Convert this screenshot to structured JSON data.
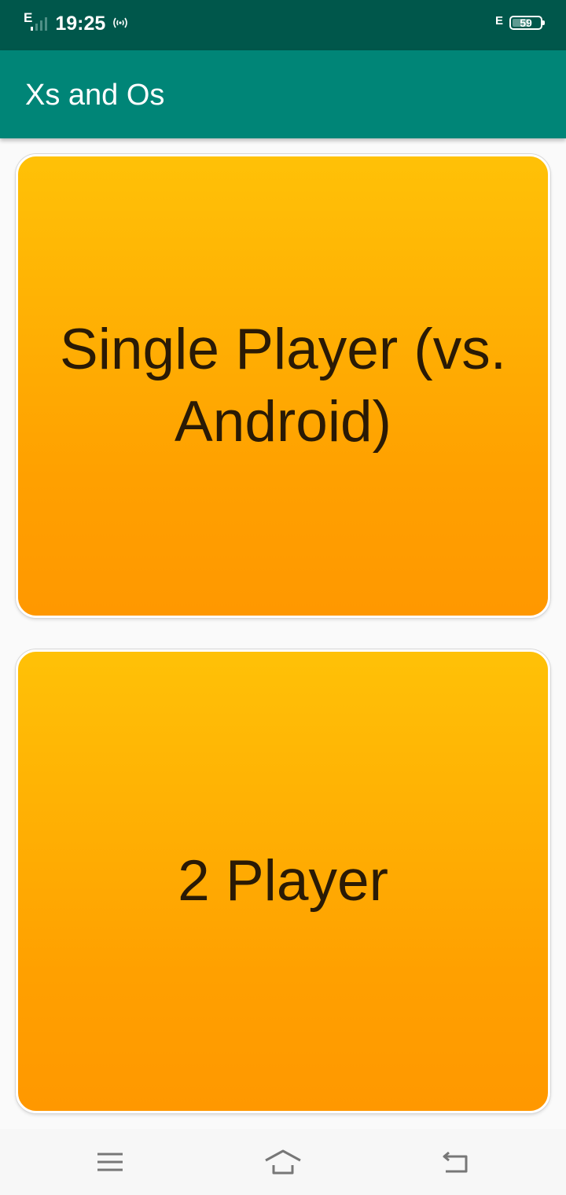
{
  "status_bar": {
    "network_type": "E",
    "time": "19:25",
    "hotspot_icon": "hotspot-icon",
    "network_type_right": "E",
    "battery_level": "59"
  },
  "app_bar": {
    "title": "Xs and Os"
  },
  "main": {
    "buttons": [
      {
        "label": "Single Player (vs. Android)"
      },
      {
        "label": "2 Player"
      }
    ]
  },
  "colors": {
    "status_bar": "#00574b",
    "app_bar": "#008577",
    "card_top": "#ffc107",
    "card_bottom": "#ff9800",
    "card_text": "#2a1a05",
    "background": "#fafafa"
  },
  "nav_bar": {
    "icons": [
      "menu-icon",
      "home-icon",
      "back-icon"
    ]
  }
}
